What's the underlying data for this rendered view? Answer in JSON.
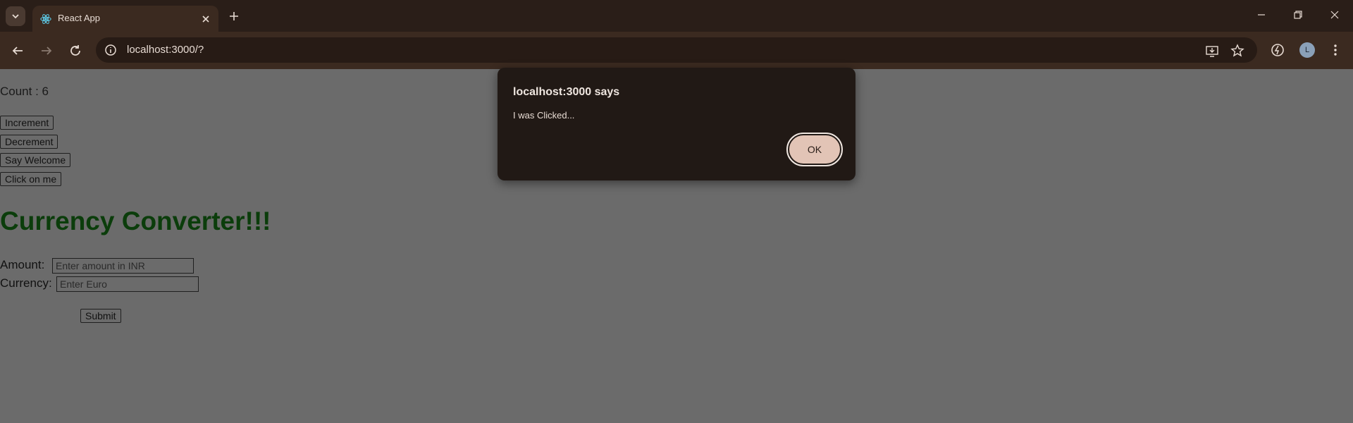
{
  "browser": {
    "tab_title": "React App",
    "url": "localhost:3000/?"
  },
  "page": {
    "count_text": "Count : 6",
    "buttons": {
      "increment": "Increment",
      "decrement": "Decrement",
      "say_welcome": "Say Welcome",
      "click_on_me": "Click on me"
    },
    "heading": "Currency Converter!!!",
    "amount_label": "Amount:",
    "amount_placeholder": "Enter amount in INR",
    "currency_label": "Currency:",
    "currency_placeholder": "Enter Euro",
    "submit_label": "Submit"
  },
  "dialog": {
    "title": "localhost:3000 says",
    "message": "I was Clicked...",
    "ok_label": "OK"
  },
  "profile": {
    "initial": "L"
  },
  "colors": {
    "frame": "#2a1e18",
    "toolbar": "#3b2a20",
    "dim_page": "#6b6b6b",
    "heading": "#0b3d0b",
    "dialog_bg": "#211915",
    "ok_button": "#e2c4b6"
  },
  "icons": [
    "tab-search-icon",
    "react-logo-icon",
    "close-icon",
    "plus-icon",
    "minimize-icon",
    "restore-icon",
    "window-close-icon",
    "back-arrow-icon",
    "forward-arrow-icon",
    "reload-icon",
    "info-icon",
    "install-app-icon",
    "star-icon",
    "extension-icon",
    "menu-kebab-icon"
  ]
}
